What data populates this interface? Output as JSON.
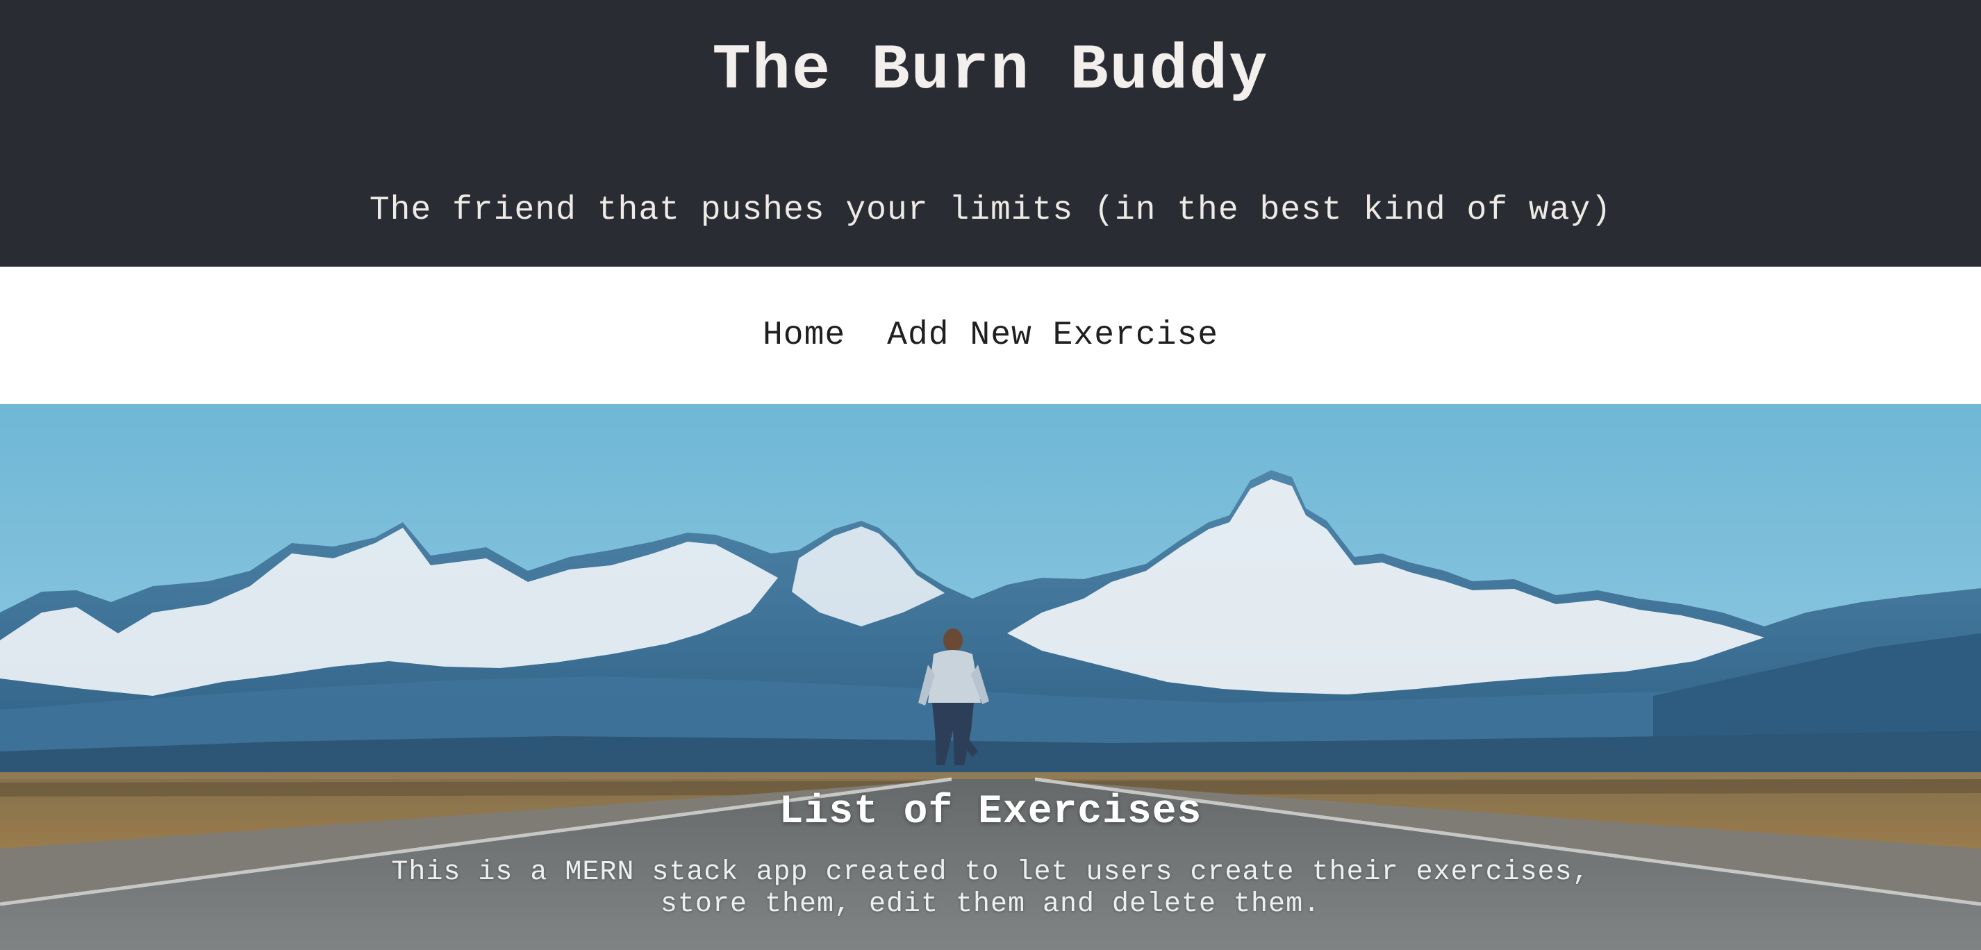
{
  "header": {
    "title": "The Burn Buddy",
    "tagline": "The friend that pushes your limits (in the best kind of way)"
  },
  "nav": {
    "items": [
      {
        "label": "Home"
      },
      {
        "label": "Add New Exercise"
      }
    ]
  },
  "main": {
    "section_title": "List of Exercises",
    "description": "This is a MERN stack app created to let users create their exercises, store them, edit them and delete them."
  },
  "colors": {
    "header_bg": "#2a2c33",
    "header_text": "#f3efec",
    "nav_bg": "#ffffff",
    "nav_text": "#1f1f1f"
  }
}
